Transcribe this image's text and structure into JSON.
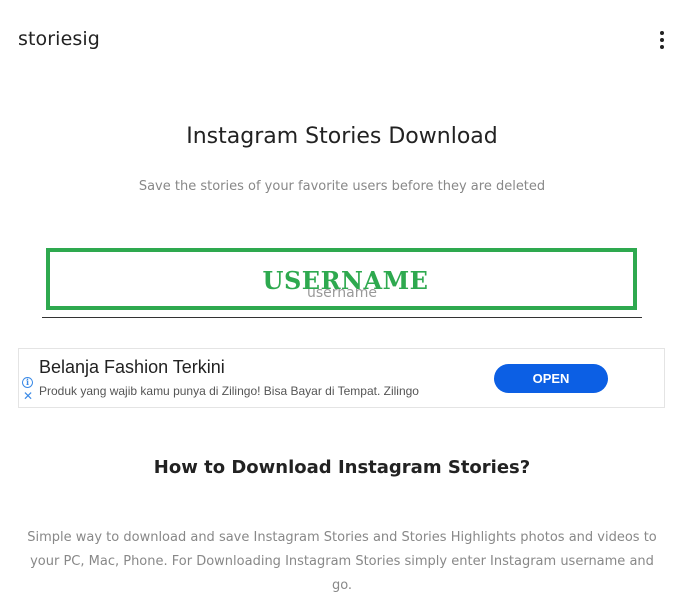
{
  "header": {
    "brand": "storiesig",
    "menu_icon": "more-vert-icon"
  },
  "hero": {
    "title": "Instagram Stories Download",
    "subtitle": "Save the stories of your favorite users before they are deleted"
  },
  "search": {
    "placeholder": "username",
    "highlight_label": "USERNAME",
    "highlight_color": "#2ea94f"
  },
  "ad": {
    "title": "Belanja Fashion Terkini",
    "description": "Produk yang wajib kamu punya di Zilingo! Bisa Bayar di Tempat. Zilingo",
    "cta_label": "OPEN",
    "cta_color": "#0c5fe4",
    "info_glyph": "i",
    "close_glyph": "✕"
  },
  "howto": {
    "title": "How to Download Instagram Stories?",
    "body": "Simple way to download and save Instagram Stories and Stories Highlights photos and videos to your PC, Mac, Phone. For Downloading Instagram Stories simply enter Instagram username and go."
  }
}
